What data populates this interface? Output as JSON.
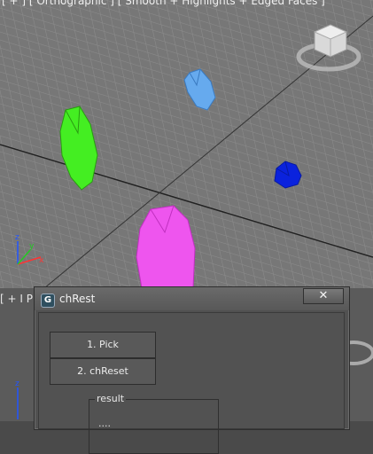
{
  "viewport": {
    "label": "[ + ] [ Orthographic ] [ Smooth + Highlights + Edged Faces ]",
    "axes": {
      "x": "x",
      "y": "y",
      "z": "z"
    },
    "colors": {
      "background": "#777777",
      "grid": "#8a8a8a",
      "main_axis": "#222222",
      "green_object": "#44ee22",
      "light_blue_object": "#66aaee",
      "dark_blue_object": "#0a22dd",
      "magenta_object": "#ee55ee"
    }
  },
  "bottom_viewport": {
    "label": "[ + I P"
  },
  "dialog": {
    "title": "chRest",
    "close": "✕",
    "buttons": {
      "pick": "1. Pick",
      "reset": "2. chReset"
    },
    "result_group": {
      "label": "result",
      "text": "...."
    }
  }
}
